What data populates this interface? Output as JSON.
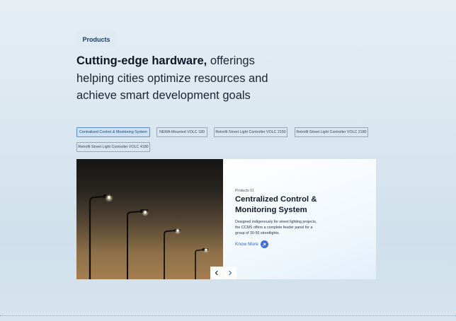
{
  "section": {
    "badge": "Products"
  },
  "headline": {
    "bold": "Cutting-edge hardware,",
    "rest": " offerings helping cities optimize resources and achieve smart development goals"
  },
  "tabs": [
    {
      "label": "Centralized Control & Monitoring System",
      "active": true
    },
    {
      "label": "NEMA-Mounted VOLC 180",
      "active": false
    },
    {
      "label": "Retrofit Street Light Controller VOLC 2150",
      "active": false
    },
    {
      "label": "Retrofit Street Light Controller VOLC 2180",
      "active": false
    },
    {
      "label": "Retrofit Street Light Controller VOLC 4180",
      "active": false
    }
  ],
  "card": {
    "breadcrumb": "Products  01",
    "title": "Centralized Control & Monitoring System",
    "description": "Designed indigenously for street lighting projects, the CCMS offers a complete feeder panel for a group of 30-50 streetlights.",
    "cta": "Know More",
    "prev_icon": "chevron-left-icon",
    "next_icon": "chevron-right-icon"
  },
  "colors": {
    "accent": "#3b6fd4",
    "active_tab_bg": "#cfe1f7"
  }
}
